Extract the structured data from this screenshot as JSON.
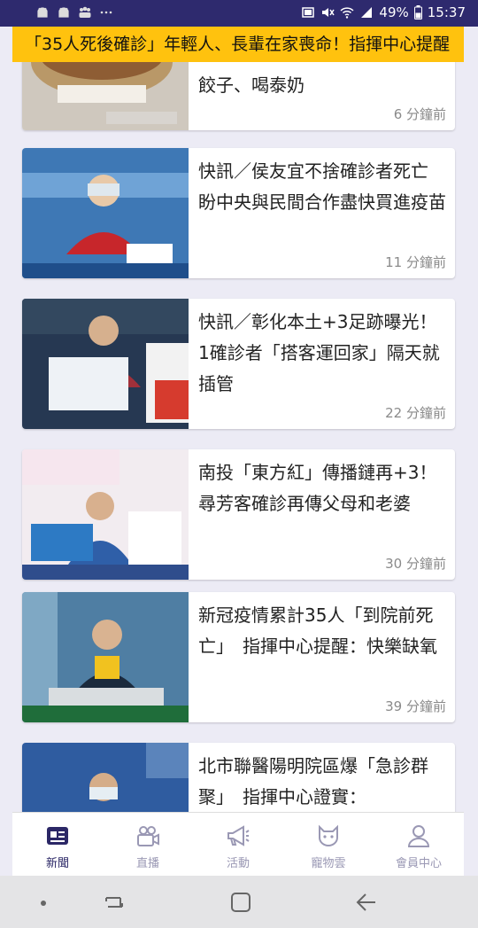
{
  "status_bar": {
    "battery": "49%",
    "time": "15:37",
    "left_icons": [
      "android-icon",
      "android-icon",
      "people-icon",
      "more-icon"
    ],
    "right_icons": [
      "cast-icon",
      "mute-icon",
      "wifi-icon",
      "signal-icon"
    ]
  },
  "ticker": {
    "text": "「35人死後確診」年輕人、長輩在家喪命！指揮中心提醒"
  },
  "articles": [
    {
      "title": "餃子、喝泰奶",
      "time": "6 分鐘前",
      "thumb_icon": "food-photo"
    },
    {
      "title": "快訊／侯友宜不捨確診者死亡　盼中央與民間合作盡快買進疫苗",
      "time": "11 分鐘前",
      "thumb_icon": "press-conference-photo"
    },
    {
      "title": "快訊／彰化本土+3足跡曝光！1確診者「搭客運回家」隔天就插管",
      "time": "22 分鐘前",
      "thumb_icon": "press-conference-photo"
    },
    {
      "title": "南投「東方紅」傳播鏈再+3！尋芳客確診再傳父母和老婆",
      "time": "30 分鐘前",
      "thumb_icon": "press-conference-photo"
    },
    {
      "title": "新冠疫情累計35人「到院前死亡」　指揮中心提醒：快樂缺氧",
      "time": "39 分鐘前",
      "thumb_icon": "press-conference-photo"
    },
    {
      "title": "北市聯醫陽明院區爆「急診群聚」　指揮中心證實：",
      "time": "",
      "thumb_icon": "press-conference-photo"
    }
  ],
  "tabs": [
    {
      "label": "新聞",
      "icon": "news-icon",
      "active": true
    },
    {
      "label": "直播",
      "icon": "live-camera-icon",
      "active": false
    },
    {
      "label": "活動",
      "icon": "megaphone-icon",
      "active": false
    },
    {
      "label": "寵物雲",
      "icon": "pet-icon",
      "active": false
    },
    {
      "label": "會員中心",
      "icon": "member-icon",
      "active": false
    }
  ],
  "colors": {
    "status_bar": "#2e2a6e",
    "ticker": "#ffc20e",
    "active_tab": "#2b2766",
    "inactive_tab": "#9a98b4",
    "background": "#ecebf5"
  }
}
